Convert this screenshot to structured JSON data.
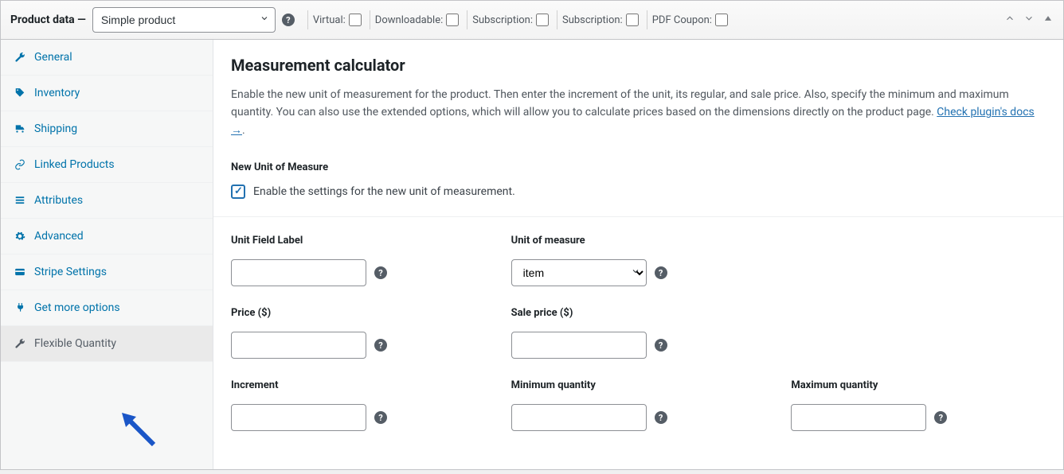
{
  "header": {
    "title": "Product data —",
    "product_type": "Simple product",
    "checks": [
      {
        "label": "Virtual:"
      },
      {
        "label": "Downloadable:"
      },
      {
        "label": "Subscription:"
      },
      {
        "label": "Subscription:"
      },
      {
        "label": "PDF Coupon:"
      }
    ]
  },
  "sidebar": {
    "items": [
      {
        "label": "General",
        "icon": "wrench"
      },
      {
        "label": "Inventory",
        "icon": "tag"
      },
      {
        "label": "Shipping",
        "icon": "truck"
      },
      {
        "label": "Linked Products",
        "icon": "link"
      },
      {
        "label": "Attributes",
        "icon": "list"
      },
      {
        "label": "Advanced",
        "icon": "gear"
      },
      {
        "label": "Stripe Settings",
        "icon": "card"
      },
      {
        "label": "Get more options",
        "icon": "plug"
      },
      {
        "label": "Flexible Quantity",
        "icon": "wrench",
        "active": true
      }
    ]
  },
  "content": {
    "title": "Measurement calculator",
    "description": "Enable the new unit of measurement for the product. Then enter the increment of the unit, its regular, and sale price. Also, specify the minimum and maximum quantity. You can also use the extended options, which will allow you to calculate prices based on the dimensions directly on the product page. ",
    "docs_link": "Check plugin's docs →",
    "section_label": "New Unit of Measure",
    "enable_label": "Enable the settings for the new unit of measurement.",
    "fields": {
      "unit_field_label": {
        "label": "Unit Field Label",
        "value": ""
      },
      "unit_of_measure": {
        "label": "Unit of measure",
        "value": "item"
      },
      "price": {
        "label": "Price ($)",
        "value": ""
      },
      "sale_price": {
        "label": "Sale price ($)",
        "value": ""
      },
      "increment": {
        "label": "Increment",
        "value": ""
      },
      "min_qty": {
        "label": "Minimum quantity",
        "value": ""
      },
      "max_qty": {
        "label": "Maximum quantity",
        "value": ""
      }
    }
  }
}
